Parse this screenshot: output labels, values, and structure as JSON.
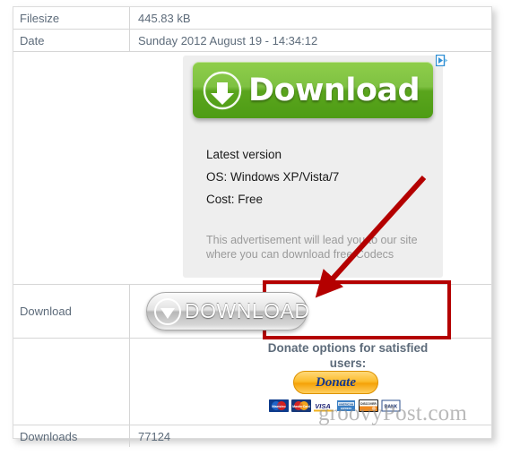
{
  "table": {
    "rows": [
      {
        "label": "Filesize",
        "value": "445.83 kB"
      },
      {
        "label": "Date",
        "value": "Sunday 2012 August 19 - 14:34:12"
      },
      {
        "label": "Download",
        "value": ""
      },
      {
        "label": "Downloads",
        "value": "77124"
      }
    ]
  },
  "advertisement": {
    "adchoices_label": "AdChoices",
    "button_label": "Download",
    "line_1": "Latest version",
    "line_2": "OS: Windows XP/Vista/7",
    "line_3": "Cost: Free",
    "disclaimer": "This advertisement will lead you to our site where you can download free Codecs",
    "panel_bg": "#eeeeee",
    "button_green_top": "#8fce4a",
    "button_green_bottom": "#4e9c15",
    "adchoices_blue": "#2f8fd4"
  },
  "download_row": {
    "label": "Download",
    "button_label": "DOWNLOAD",
    "highlight_color": "#b40000",
    "arrow_color": "#b40000"
  },
  "donate": {
    "heading": "Donate options for satisfied users:",
    "button_label": "Donate",
    "button_color": "#f5a209",
    "button_text_color": "#16388c",
    "cards": [
      {
        "name": "maestro-card-logo",
        "text": "Maestro"
      },
      {
        "name": "mastercard-card-logo",
        "text": "MasterCard"
      },
      {
        "name": "visa-card-logo",
        "text": "VISA"
      },
      {
        "name": "american-express-card-logo",
        "text": "AMERICAN EXPRESS"
      },
      {
        "name": "discover-card-logo",
        "text": "DISCOVER"
      },
      {
        "name": "bank-transfer-logo",
        "text": "BANK"
      }
    ]
  },
  "watermark": {
    "text": "groovyPost.com"
  }
}
